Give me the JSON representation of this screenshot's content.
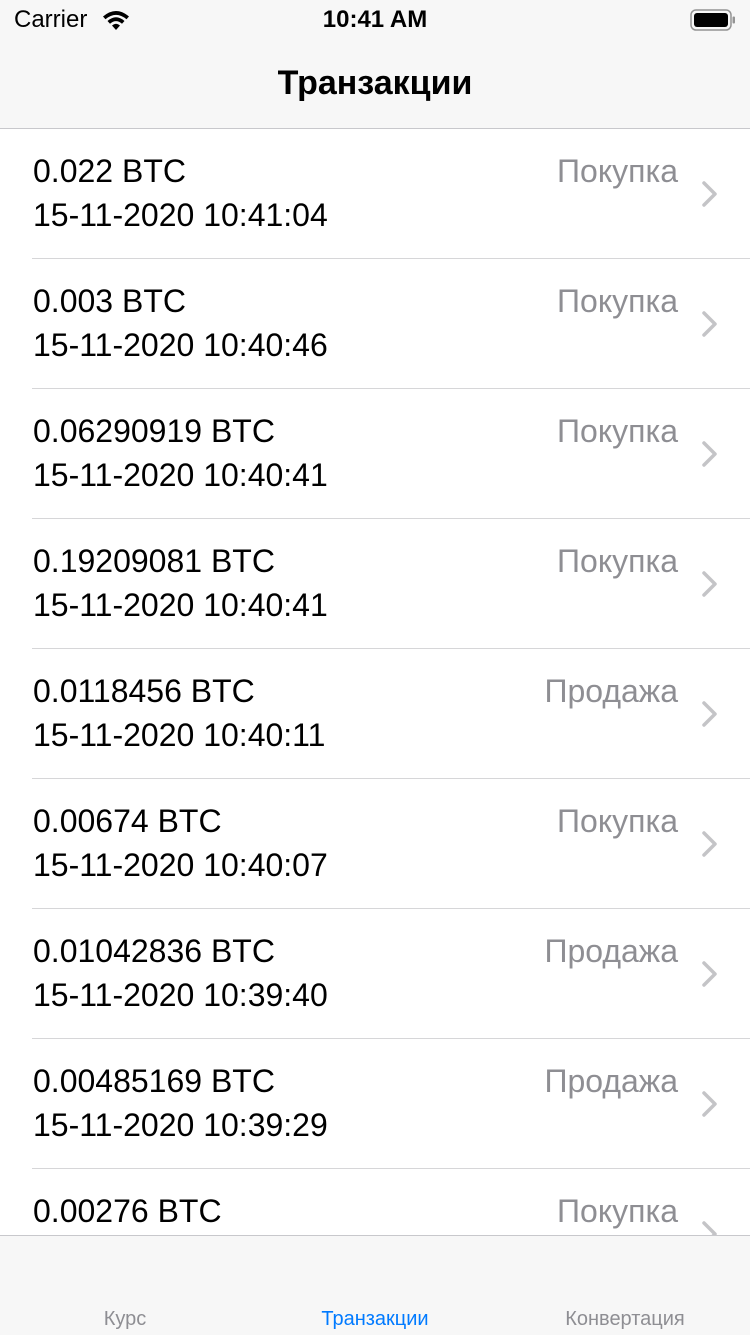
{
  "status_bar": {
    "carrier": "Carrier",
    "time": "10:41 AM",
    "wifi_icon": "wifi-icon",
    "battery_icon": "battery-icon"
  },
  "nav": {
    "title": "Транзакции"
  },
  "transactions": [
    {
      "amount": "0.022 BTC",
      "date": "15-11-2020 10:41:04",
      "type": "Покупка"
    },
    {
      "amount": "0.003 BTC",
      "date": "15-11-2020 10:40:46",
      "type": "Покупка"
    },
    {
      "amount": "0.06290919 BTC",
      "date": "15-11-2020 10:40:41",
      "type": "Покупка"
    },
    {
      "amount": "0.19209081 BTC",
      "date": "15-11-2020 10:40:41",
      "type": "Покупка"
    },
    {
      "amount": "0.0118456 BTC",
      "date": "15-11-2020 10:40:11",
      "type": "Продажа"
    },
    {
      "amount": "0.00674 BTC",
      "date": "15-11-2020 10:40:07",
      "type": "Покупка"
    },
    {
      "amount": "0.01042836 BTC",
      "date": "15-11-2020 10:39:40",
      "type": "Продажа"
    },
    {
      "amount": "0.00485169 BTC",
      "date": "15-11-2020 10:39:29",
      "type": "Продажа"
    },
    {
      "amount": "0.00276 BTC",
      "date": "",
      "type": "Покупка"
    }
  ],
  "tabs": [
    {
      "label": "Курс",
      "active": false
    },
    {
      "label": "Транзакции",
      "active": true
    },
    {
      "label": "Конвертация",
      "active": false
    }
  ],
  "colors": {
    "accent": "#007aff",
    "secondary_text": "#8e8e93",
    "bar_background": "#f7f7f7"
  }
}
